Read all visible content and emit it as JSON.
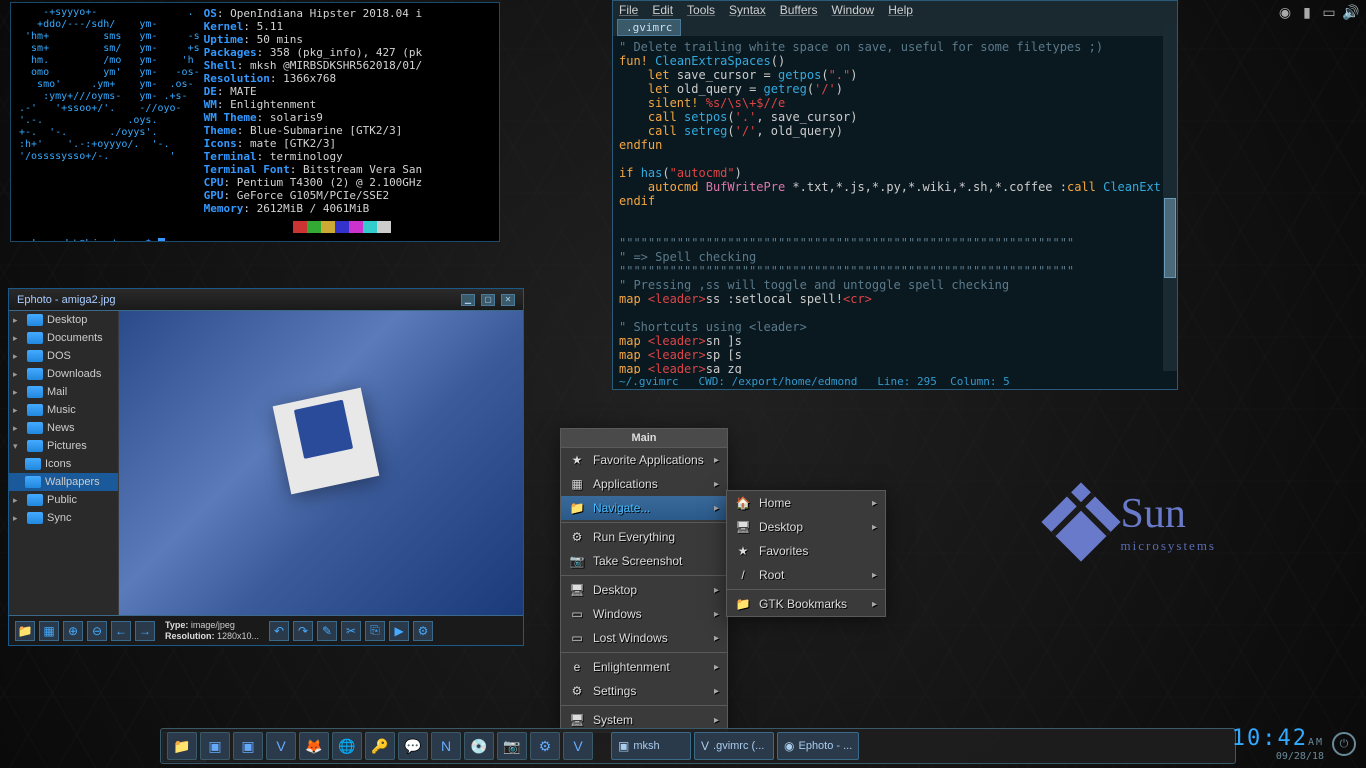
{
  "neofetch": {
    "ascii": "    -+syyyo+-               .\n   +ddo/---/sdh/    ym-\n 'hm+         sms   ym-     -s\n  sm+         sm/   ym-     +s\n  hm.         /mo   ym-    'h\n  omo         ym'   ym-   -os-\n   smo'     .ym+    ym-  .os-\n    :ymy+///oyms-   ym- .+s-\n.-'   '+ssoo+/'.    -//oyo-\n'.-.              .oys.\n+-.  '-.       ./oyys'.\n:h+'    '.-:+oyyyo/.  '-.\n'/ossssysso+/-.          '",
    "info": [
      {
        "k": "OS",
        "v": "OpenIndiana Hipster 2018.04 i"
      },
      {
        "k": "Kernel",
        "v": "5.11"
      },
      {
        "k": "Uptime",
        "v": "50 mins"
      },
      {
        "k": "Packages",
        "v": "358 (pkg_info), 427 (pk"
      },
      {
        "k": "Shell",
        "v": "mksh @MIRBSDKSHR562018/01/"
      },
      {
        "k": "Resolution",
        "v": "1366x768"
      },
      {
        "k": "DE",
        "v": "MATE"
      },
      {
        "k": "WM",
        "v": "Enlightenment"
      },
      {
        "k": "WM Theme",
        "v": "solaris9"
      },
      {
        "k": "Theme",
        "v": "Blue-Submarine [GTK2/3]"
      },
      {
        "k": "Icons",
        "v": "mate [GTK2/3]"
      },
      {
        "k": "Terminal",
        "v": "terminology"
      },
      {
        "k": "Terminal Font",
        "v": "Bitstream Vera San"
      },
      {
        "k": "CPU",
        "v": "Pentium T4300 (2) @ 2.100GHz"
      },
      {
        "k": "GPU",
        "v": "GeForce G105M/PCIe/SSE2"
      },
      {
        "k": "Memory",
        "v": "2612MiB / 4061MiB"
      }
    ],
    "swatches": [
      "#000",
      "#c33",
      "#3a3",
      "#ca3",
      "#33c",
      "#c3c",
      "#3cc",
      "#ccc"
    ],
    "prompt_user": "sehnsucht",
    "prompt_host": "hipster",
    "prompt_path": "~"
  },
  "gvim": {
    "menus": [
      "File",
      "Edit",
      "Tools",
      "Syntax",
      "Buffers",
      "Window",
      "Help"
    ],
    "tab": ".gvimrc",
    "status_file": "~/.gvimrc",
    "status_cwd": "CWD: /export/home/edmond",
    "status_line": "Line: 295",
    "status_col": "Column: 5"
  },
  "ephoto": {
    "title": "Ephoto - amiga2.jpg",
    "folders": [
      "Desktop",
      "Documents",
      "DOS",
      "Downloads",
      "Mail",
      "Music",
      "News",
      "Pictures",
      "Public",
      "Sync"
    ],
    "subfolders": [
      "Icons",
      "Wallpapers"
    ],
    "info_type_label": "Type:",
    "info_type": "image/jpeg",
    "info_res_label": "Resolution:",
    "info_res": "1280x10..."
  },
  "menu_main": {
    "title": "Main",
    "items": [
      "Favorite Applications",
      "Applications",
      "Navigate...",
      "Run Everything",
      "Take Screenshot",
      "Desktop",
      "Windows",
      "Lost Windows",
      "Enlightenment",
      "Settings",
      "System"
    ],
    "selected": 2
  },
  "menu_nav": {
    "items": [
      "Home",
      "Desktop",
      "Favorites",
      "Root",
      "GTK Bookmarks"
    ]
  },
  "tray_icons": [
    "wifi",
    "battery",
    "screen",
    "volume"
  ],
  "logo": {
    "name": "Sun",
    "sub": "microsystems"
  },
  "taskbar": {
    "launchers": [
      "files",
      "term",
      "term2",
      "vim",
      "firefox",
      "globe",
      "keys",
      "chat",
      "news",
      "disc",
      "cam",
      "settings",
      "vim2"
    ],
    "windows": [
      {
        "icon": "▣",
        "label": "mksh"
      },
      {
        "icon": "V",
        "label": ".gvimrc (..."
      },
      {
        "icon": "◉",
        "label": "Ephoto - ..."
      }
    ]
  },
  "clock": {
    "time": "10:42",
    "ampm": "AM",
    "date": "09/28/18"
  }
}
